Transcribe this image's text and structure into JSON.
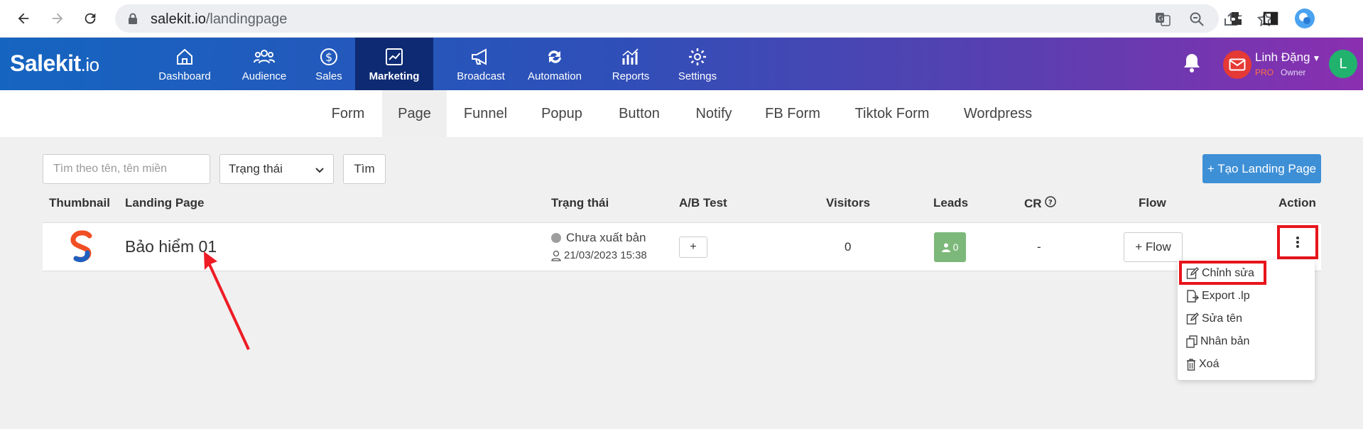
{
  "browser": {
    "url_host": "salekit.io",
    "url_path": "/landingpage",
    "icons": [
      "back-arrow-icon",
      "forward-arrow-icon",
      "reload-icon",
      "lock-icon",
      "translate-icon",
      "zoom-icon",
      "share-icon",
      "star-icon",
      "extensions-icon",
      "sidepanel-icon",
      "profile-icon"
    ]
  },
  "header": {
    "logo_main": "Salekit",
    "logo_tld": ".io",
    "menu": [
      {
        "label": "Dashboard",
        "icon": "home-icon"
      },
      {
        "label": "Audience",
        "icon": "users-icon"
      },
      {
        "label": "Sales",
        "icon": "dollar-icon"
      },
      {
        "label": "Marketing",
        "icon": "chart-icon",
        "active": true
      },
      {
        "label": "Broadcast",
        "icon": "megaphone-icon"
      },
      {
        "label": "Automation",
        "icon": "repeat-icon"
      },
      {
        "label": "Reports",
        "icon": "stats-icon"
      },
      {
        "label": "Settings",
        "icon": "gear-icon"
      }
    ],
    "user": {
      "name": "Linh Đặng",
      "plan": "PRO",
      "role": "Owner",
      "avatar_letter": "L"
    },
    "colors": {
      "brand_blue": "#1565c0",
      "brand_purple": "#8a2fb0",
      "active_menu": "#0d2a73"
    }
  },
  "subtabs": [
    "Form",
    "Page",
    "Funnel",
    "Popup",
    "Button",
    "Notify",
    "FB Form",
    "Tiktok Form",
    "Wordpress"
  ],
  "subtab_active": "Page",
  "toolbar": {
    "search_placeholder": "Tìm theo tên, tên miền",
    "status_select": "Trạng thái",
    "find_label": "Tìm",
    "create_label": "+ Tạo Landing Page"
  },
  "table": {
    "columns": [
      "Thumbnail",
      "Landing Page",
      "Trạng thái",
      "A/B Test",
      "Visitors",
      "Leads",
      "CR",
      "Flow",
      "Action"
    ],
    "rows": [
      {
        "name": "Bảo hiểm 01",
        "status": "Chưa xuất bản",
        "date": "21/03/2023 15:38",
        "ab_label": "+",
        "visitors": "0",
        "leads": "0",
        "cr": "-",
        "flow_label": "+ Flow"
      }
    ]
  },
  "action_menu": [
    {
      "label": "Chỉnh sửa",
      "icon": "edit-icon"
    },
    {
      "label": "Export .lp",
      "icon": "export-icon"
    },
    {
      "label": "Sửa tên",
      "icon": "rename-icon"
    },
    {
      "label": "Nhân bản",
      "icon": "copy-icon"
    },
    {
      "label": "Xoá",
      "icon": "trash-icon"
    }
  ]
}
